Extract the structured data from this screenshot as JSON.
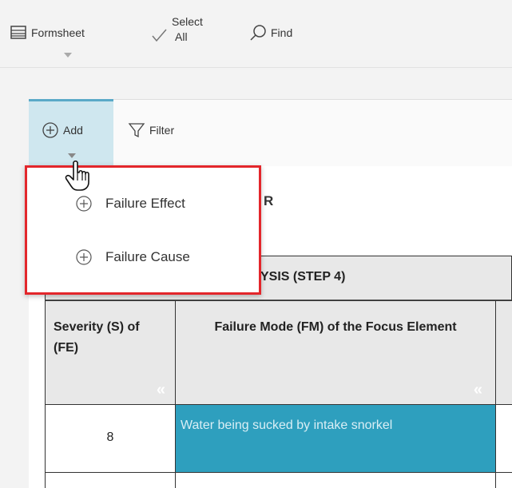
{
  "ribbon": {
    "formsheet_label": "Formsheet",
    "select_all_line1": "Select",
    "select_all_line2": "All",
    "find_label": "Find"
  },
  "subtoolbar": {
    "add_label": "Add",
    "filter_label": "Filter"
  },
  "dropdown": {
    "items": [
      {
        "label": "Failure Effect",
        "icon": "plus-circle-icon"
      },
      {
        "label": "Failure Cause",
        "icon": "plus-circle-icon"
      }
    ]
  },
  "table": {
    "partial_header_r": "R",
    "section_title_partial": "YSIS (STEP 4)",
    "col_severity": "Severity (S) of (FE)",
    "col_failure_mode": "Failure Mode (FM) of the Focus Element",
    "collapse_glyph": "«",
    "rows": [
      {
        "severity": "8",
        "failure_mode": "Water being sucked by intake snorkel"
      }
    ]
  },
  "colors": {
    "accent_selected_bg": "#cfe7ef",
    "accent_border": "#5aa9c8",
    "dropdown_highlight": "#e3262b",
    "selected_cell_bg": "#2e9fbe"
  }
}
